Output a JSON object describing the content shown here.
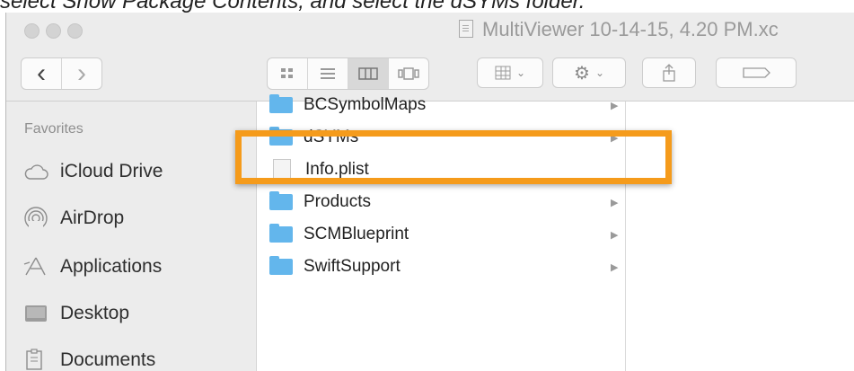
{
  "caption": {
    "text": "select Show Package Contents, and select the dSYMs folder."
  },
  "window": {
    "title": "MultiViewer 10-14-15, 4.20 PM.xc"
  },
  "toolbar": {
    "nav_back": "‹",
    "nav_forward": "›",
    "view_modes": [
      "icon-view",
      "list-view",
      "column-view",
      "cover-flow-view"
    ],
    "active_view": "column-view"
  },
  "sidebar": {
    "section_title": "Favorites",
    "items": [
      {
        "label": "iCloud Drive",
        "icon": "cloud-icon"
      },
      {
        "label": "AirDrop",
        "icon": "airdrop-icon"
      },
      {
        "label": "Applications",
        "icon": "applications-icon"
      },
      {
        "label": "Desktop",
        "icon": "desktop-icon"
      },
      {
        "label": "Documents",
        "icon": "documents-icon"
      }
    ]
  },
  "files": [
    {
      "name": "BCSymbolMaps",
      "type": "folder",
      "has_children": true
    },
    {
      "name": "dSYMs",
      "type": "folder",
      "has_children": true,
      "highlighted": true
    },
    {
      "name": "Info.plist",
      "type": "file",
      "has_children": false
    },
    {
      "name": "Products",
      "type": "folder",
      "has_children": true
    },
    {
      "name": "SCMBlueprint",
      "type": "folder",
      "has_children": true
    },
    {
      "name": "SwiftSupport",
      "type": "folder",
      "has_children": true
    }
  ],
  "colors": {
    "highlight": "#f59b1b",
    "folder": "#63b6ec"
  }
}
